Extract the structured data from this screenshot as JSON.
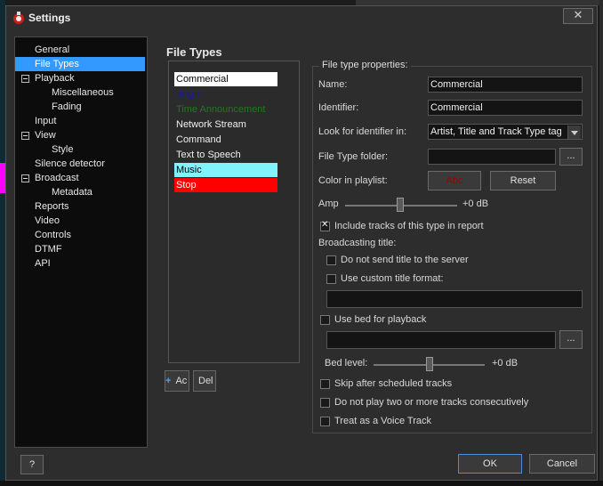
{
  "window": {
    "title": "Settings",
    "close_glyph": "✕"
  },
  "tree": {
    "items": [
      {
        "label": "General",
        "level": 0
      },
      {
        "label": "File Types",
        "level": 0,
        "selected": true
      },
      {
        "label": "Playback",
        "level": 0,
        "expanded": true
      },
      {
        "label": "Miscellaneous",
        "level": 1
      },
      {
        "label": "Fading",
        "level": 1
      },
      {
        "label": "Input",
        "level": 0
      },
      {
        "label": "View",
        "level": 0,
        "expanded": true
      },
      {
        "label": "Style",
        "level": 1
      },
      {
        "label": "Silence detector",
        "level": 0
      },
      {
        "label": "Broadcast",
        "level": 0,
        "expanded": true
      },
      {
        "label": "Metadata",
        "level": 1
      },
      {
        "label": "Reports",
        "level": 0
      },
      {
        "label": "Video",
        "level": 0
      },
      {
        "label": "Controls",
        "level": 0
      },
      {
        "label": "DTMF",
        "level": 0
      },
      {
        "label": "API",
        "level": 0
      }
    ]
  },
  "section_title": "File Types",
  "file_types": [
    {
      "label": "Commercial",
      "bg": "#ffffff",
      "fg": "#000000"
    },
    {
      "label": "Jingle",
      "bg": "",
      "fg": "#1a1aa0"
    },
    {
      "label": "Time Announcement",
      "bg": "",
      "fg": "#1f7a1f"
    },
    {
      "label": "Network Stream",
      "bg": "",
      "fg": "#f0f0f0"
    },
    {
      "label": "Command",
      "bg": "",
      "fg": "#f0f0f0"
    },
    {
      "label": "Text to Speech",
      "bg": "",
      "fg": "#f0f0f0"
    },
    {
      "label": "Music",
      "bg": "#7ff4ff",
      "fg": "#000000"
    },
    {
      "label": "Stop",
      "bg": "#ff0000",
      "fg": "#ffffff"
    }
  ],
  "list_buttons": {
    "add": "Ac",
    "delete": "Del"
  },
  "properties": {
    "group_title": "File type properties:",
    "name_label": "Name:",
    "name_value": "Commercial",
    "identifier_label": "Identifier:",
    "identifier_value": "Commercial",
    "look_label": "Look for identifier in:",
    "look_value": "Artist, Title and Track Type tag",
    "folder_label": "File Type folder:",
    "folder_value": "",
    "browse_label": "...",
    "color_label": "Color in playlist:",
    "color_button_label": "Abc",
    "reset_label": "Reset",
    "amp_label": "Amp",
    "amp_value": "+0 dB",
    "include_label": "Include tracks of this type in report",
    "broadcasting_label": "Broadcasting title:",
    "no_send_label": "Do not send title to the server",
    "custom_format_label": "Use custom title format:",
    "custom_format_value": "",
    "use_bed_label": "Use bed for playback",
    "bed_value": "",
    "bed_browse_label": "...",
    "bed_level_label": "Bed level:",
    "bed_level_value": "+0 dB",
    "skip_label": "Skip after scheduled tracks",
    "no_consecutive_label": "Do not play two or more tracks consecutively",
    "voice_track_label": "Treat as a Voice Track"
  },
  "footer": {
    "help": "?",
    "ok": "OK",
    "cancel": "Cancel"
  },
  "colors": {
    "selection": "#3399ff",
    "ok_border": "#4c8ed6"
  }
}
